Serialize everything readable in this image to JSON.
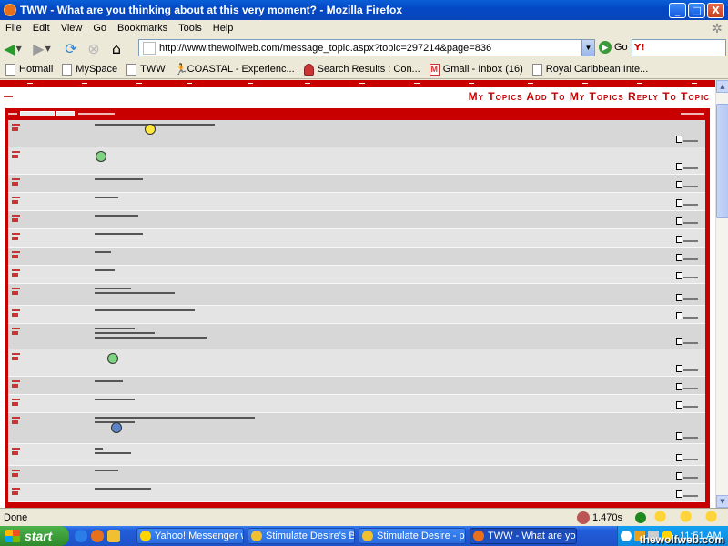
{
  "window": {
    "title": "TWW - What are you thinking about at this very moment? - Mozilla Firefox",
    "minimize": "_",
    "maximize": "□",
    "close": "X"
  },
  "menu": [
    "File",
    "Edit",
    "View",
    "Go",
    "Bookmarks",
    "Tools",
    "Help"
  ],
  "toolbar": {
    "url": "http://www.thewolfweb.com/message_topic.aspx?topic=297214&page=836",
    "go_label": "Go"
  },
  "bookmarks": [
    {
      "label": "Hotmail",
      "icon": "page-icon"
    },
    {
      "label": "MySpace",
      "icon": "page-icon"
    },
    {
      "label": "TWW",
      "icon": "page-icon"
    },
    {
      "label": "COASTAL - Experienc...",
      "icon": "runner-icon"
    },
    {
      "label": "Search Results : Con...",
      "icon": "heart-icon"
    },
    {
      "label": "Gmail - Inbox (16)",
      "icon": "gmail-icon"
    },
    {
      "label": "Royal Caribbean Inte...",
      "icon": "page-icon"
    }
  ],
  "page": {
    "topic_links": "My Topics Add To My Topics Reply To Topic"
  },
  "posts": [
    {
      "lines": [
        60
      ],
      "smiley": "yellow",
      "height": 30
    },
    {
      "lines": [],
      "smiley": "green",
      "height": 30
    },
    {
      "lines": [
        24
      ],
      "smiley": null,
      "height": 20
    },
    {
      "lines": [
        12
      ],
      "smiley": null,
      "height": 20
    },
    {
      "lines": [
        22
      ],
      "smiley": null,
      "height": 20
    },
    {
      "lines": [
        24
      ],
      "smiley": null,
      "height": 20
    },
    {
      "lines": [
        8
      ],
      "smiley": null,
      "height": 20
    },
    {
      "lines": [
        10
      ],
      "smiley": null,
      "height": 20
    },
    {
      "lines": [
        18,
        40
      ],
      "smiley": null,
      "height": 24
    },
    {
      "lines": [
        50
      ],
      "smiley": null,
      "height": 20
    },
    {
      "lines": [
        20,
        30,
        56
      ],
      "smiley": null,
      "height": 28
    },
    {
      "lines": [],
      "smiley": "green2",
      "height": 30
    },
    {
      "lines": [
        14
      ],
      "smiley": null,
      "height": 20
    },
    {
      "lines": [
        20
      ],
      "smiley": null,
      "height": 20
    },
    {
      "lines": [
        80,
        20
      ],
      "smiley": "blue",
      "height": 34
    },
    {
      "lines": [
        4,
        18
      ],
      "smiley": null,
      "height": 24
    },
    {
      "lines": [
        12
      ],
      "smiley": null,
      "height": 20
    },
    {
      "lines": [
        28
      ],
      "smiley": null,
      "height": 20
    }
  ],
  "status": {
    "text": "Done",
    "timer": "1.470s"
  },
  "taskbar": {
    "start": "start",
    "tasks": [
      {
        "label": "Yahoo! Messenger wi...",
        "active": false
      },
      {
        "label": "Stimulate Desire's Bu...",
        "active": false
      },
      {
        "label": "Stimulate Desire - pu...",
        "active": false
      },
      {
        "label": "TWW - What are you...",
        "active": true
      }
    ],
    "clock": "11:51 AM",
    "watermark": "thewolfweb.com"
  }
}
